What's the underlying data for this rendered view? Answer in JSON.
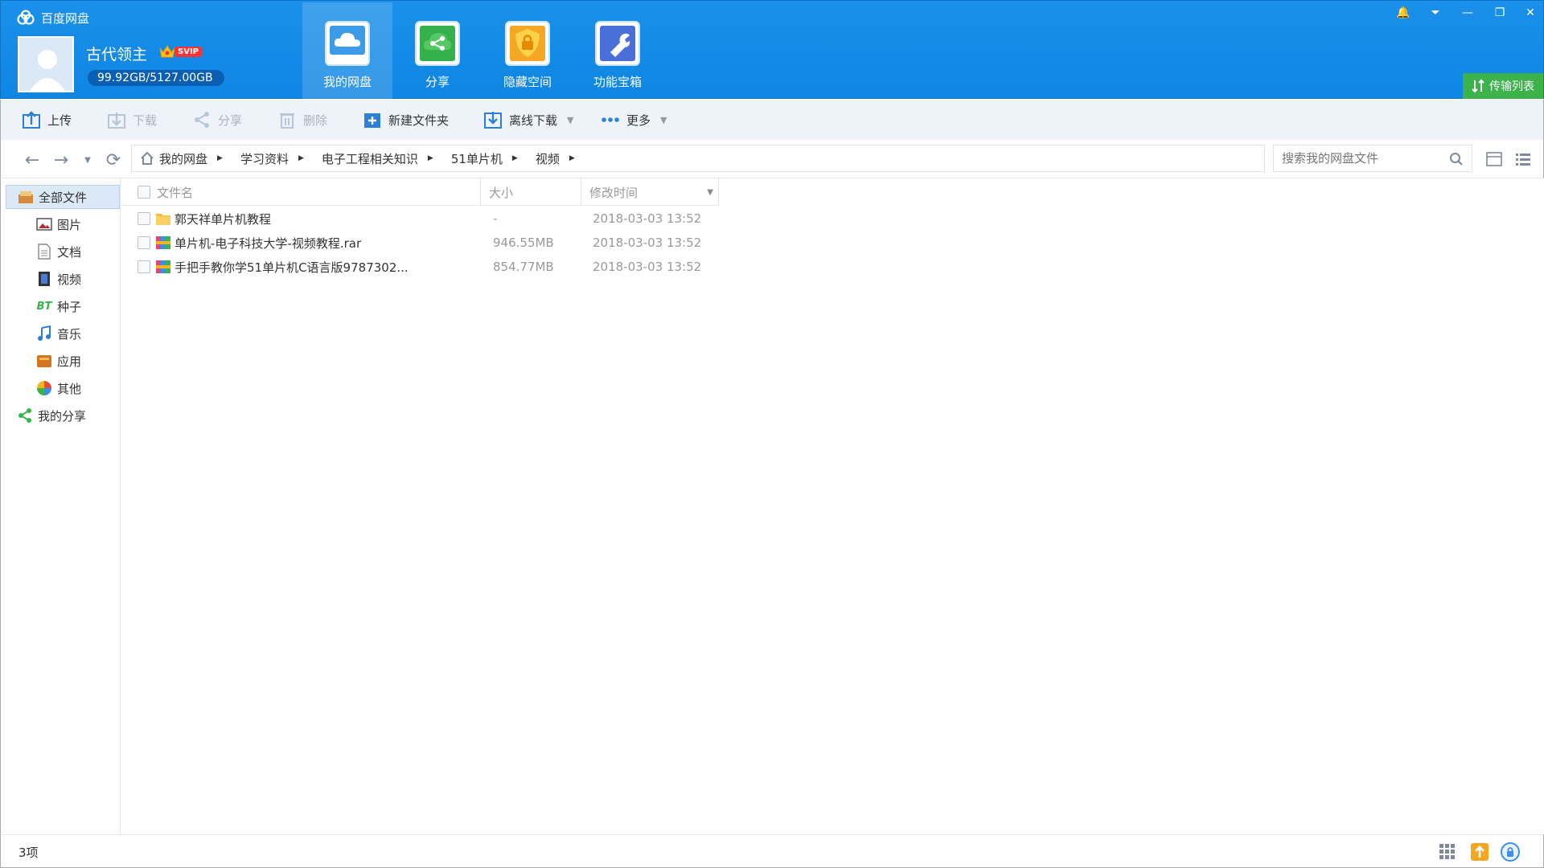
{
  "app": {
    "title": "百度网盘"
  },
  "user": {
    "name": "古代领主",
    "vip_badge": "SVIP",
    "quota": "99.92GB/5127.00GB"
  },
  "nav_tabs": [
    {
      "label": "我的网盘",
      "icon": "cloud-icon",
      "active": true
    },
    {
      "label": "分享",
      "icon": "share-icon",
      "active": false
    },
    {
      "label": "隐藏空间",
      "icon": "lock-shield-icon",
      "active": false
    },
    {
      "label": "功能宝箱",
      "icon": "wrench-toolbox-icon",
      "active": false
    }
  ],
  "window_controls": [
    "bell-icon",
    "dropdown-icon",
    "minimize-icon",
    "restore-icon",
    "close-icon"
  ],
  "transfer_list": {
    "label": "传输列表"
  },
  "toolbar": {
    "upload": "上传",
    "download": "下载",
    "share": "分享",
    "delete": "删除",
    "new_folder": "新建文件夹",
    "offline_download": "离线下载",
    "more": "更多"
  },
  "breadcrumb": [
    "我的网盘",
    "学习资料",
    "电子工程相关知识",
    "51单片机",
    "视频"
  ],
  "search": {
    "placeholder": "搜索我的网盘文件"
  },
  "sidebar": {
    "items": [
      {
        "label": "全部文件",
        "icon": "all-files-icon"
      },
      {
        "label": "图片",
        "icon": "picture-icon"
      },
      {
        "label": "文档",
        "icon": "document-icon"
      },
      {
        "label": "视频",
        "icon": "video-icon"
      },
      {
        "label": "种子",
        "icon": "bt-torrent-icon",
        "icon_text": "BT"
      },
      {
        "label": "音乐",
        "icon": "music-icon"
      },
      {
        "label": "应用",
        "icon": "app-icon"
      },
      {
        "label": "其他",
        "icon": "other-icon"
      },
      {
        "label": "我的分享",
        "icon": "my-share-icon"
      }
    ]
  },
  "file_table": {
    "columns": {
      "name": "文件名",
      "size": "大小",
      "modified": "修改时间"
    },
    "rows": [
      {
        "name": "郭天祥单片机教程",
        "type": "folder",
        "size": "-",
        "modified": "2018-03-03 13:52"
      },
      {
        "name": "单片机-电子科技大学-视频教程.rar",
        "type": "rar",
        "size": "946.55MB",
        "modified": "2018-03-03 13:52"
      },
      {
        "name": "手把手教你学51单片机C语言版9787302...",
        "type": "rar",
        "size": "854.77MB",
        "modified": "2018-03-03 13:52"
      }
    ]
  },
  "status": {
    "item_count": "3项"
  },
  "colors": {
    "header_blue": "#0f86e3",
    "transfer_green": "#3bb34a",
    "toolbar_bg": "#eef3f9"
  }
}
